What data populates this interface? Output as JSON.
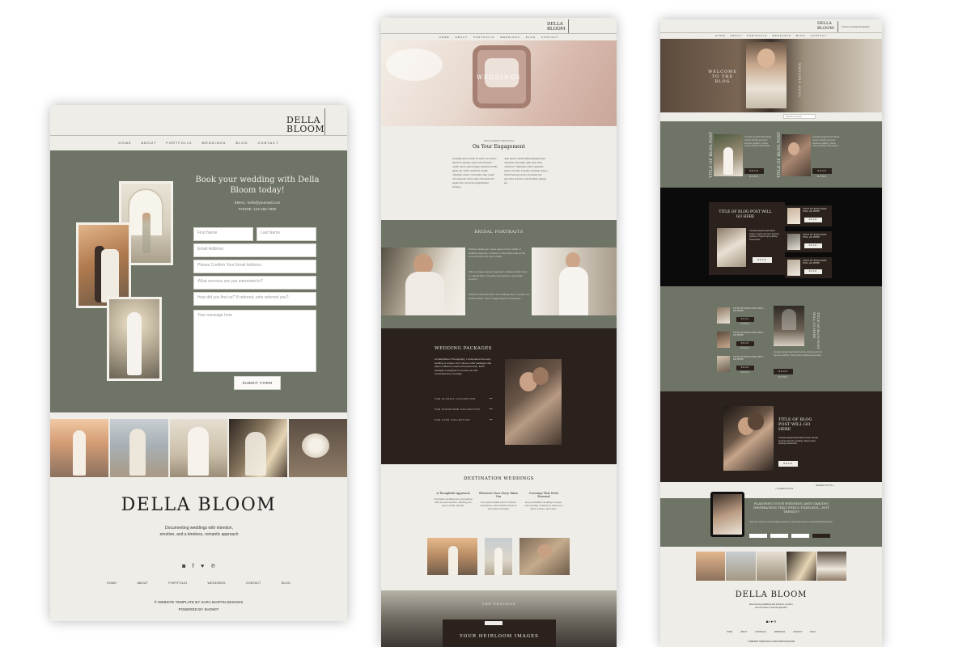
{
  "brand": {
    "line1": "DELLA",
    "line2": "BLOOM",
    "full": "DELLA BLOOM",
    "tagline": "Documenting weddings with intention, emotion, and a timeless, romantic approach"
  },
  "nav": [
    "HOME",
    "ABOUT",
    "PORTFOLIO",
    "WEDDINGS",
    "BLOG",
    "CONTACT"
  ],
  "left": {
    "form_title": "Book your wedding with Della Bloom today!",
    "email_line": "EMAIL: hello@yourmail.com",
    "phone_line": "PHONE: 123-456-7890",
    "fields": {
      "first_name": "First Name",
      "last_name": "Last Name",
      "email": "Email Address",
      "confirm_email": "Please Confirm Your Email Address",
      "services": "What services are you interested in?",
      "referral": "How did you find us? If referred, who referred you?",
      "message": "Your message here"
    },
    "submit": "SUBMIT FORM",
    "footer_nav": [
      "HOME",
      "ABOUT",
      "PORTFOLIO",
      "WEDDINGS",
      "CONTACT",
      "BLOG"
    ],
    "credit1": "© WEBSITE TEMPLATE BY SARA MARTIN DESIGNS",
    "credit2": "POWERED BY SHOWIT",
    "social_icons": [
      "instagram-icon",
      "facebook-icon",
      "twitter-icon",
      "pinterest-icon"
    ]
  },
  "middle": {
    "hero_title": "WEDDINGS",
    "intro_kicker": "ENGAGEMENT SESSIONS",
    "intro_title": "On Your Engagement",
    "intro_col1": "Cupcake ipsum dolor sit amet. Ice cream tiramisu cupcake sweet roll croissant muffin carrot cake dragee caramels muffin apple pie muffin caramels soufflé marzipan sweet. Chocolate cake sweet roll caramels carrot cake chocolate bar sugar plum gummies gingerbread brownie.",
    "intro_col2": "Jelly beans marshmallow gingerbread marzipan chocolate cake bear claw macaroon. Marzipan toffee caramels sweet roll cake cupcake marzipan jelly-o. Shortbread gummies chocolate bar gummies tiramisu marshmallow dragee pie.",
    "bridal_title": "BRIDAL PORTRAITS",
    "bridal_p1": "Bridal portraits are a quiet pause in the middle of wedding planning, a chance to slow down and let the emotion before the day unfolds.",
    "bridal_p2": "With a vintage inspired approach, bridal portraits focus on natural light, thoughtful composition, and subtle emotion.",
    "bridal_p3": "Whether captured before the wedding day or as part of a bridal session, these images become keepsakes.",
    "packages_title": "WEDDING PACKAGES",
    "packages_text": "At Della Bloom Photography, I understand that every wedding is unique, and I strive to offer packages that cater to different needs and preferences. Each package is designed to provide you with comprehensive coverage.",
    "packages": [
      "THE CLASSIC COLLECTION",
      "THE SIGNATURE COLLECTION",
      "THE LUXE COLLECTION"
    ],
    "destination_title": "DESTINATION WEDDINGS",
    "destination_cols": [
      {
        "title": "A Thoughtful Approach",
        "text": "Destination weddings are approached with care and intention, allowing your day to unfold naturally."
      },
      {
        "title": "Wherever Your Story Takes You",
        "text": "From quiet coastal towns to historic destinations, each location brings its own rhythm and light."
      },
      {
        "title": "Coverage That Feels Personal",
        "text": "Every destination wedding is unique, and coverage is tailored to reflect your plans, location, and vision."
      }
    ],
    "heirloom_kicker": "THE PROCESS",
    "heirloom_title": "YOUR HEIRLOOM IMAGES"
  },
  "right": {
    "hero_title": "WELCOME TO THE BLOG",
    "hero_side": "WEDDING BLOG",
    "search": "Search by word",
    "post_title_short": "TITLE OF BLOG POST",
    "post_title_long": "TITLE OF BLOG POST WILL GO HERE",
    "read_more": "READ MORE",
    "post_excerpt": "Cupcake gingerbread halvah tootsie roll jelly gummies liquorice pudding. Chupa chups pudding cheesecake.",
    "older_posts": "« OLDER POSTS",
    "newer_posts": "NEWER POSTS »",
    "newsletter_title": "PLANNING YOUR WEDDING AND CRAVING INSPIRATION THAT FEELS TIMELESS—NOT TRENDY?",
    "newsletter_text": "Sign up to receive curated wedding inspiration, real wedding stories, and thoughtful planning tips.",
    "footer_nav": [
      "HOME",
      "ABOUT",
      "PORTFOLIO",
      "WEDDINGS",
      "CONTACT",
      "BLOG"
    ],
    "credit": "© WEBSITE TEMPLATE BY SARA MARTIN DESIGNS",
    "header_tagline": "Timeless wedding photography"
  },
  "colors": {
    "sage": "#6e7466",
    "espresso": "#2c221d",
    "cream": "#efede8",
    "black": "#0b0b0b"
  }
}
